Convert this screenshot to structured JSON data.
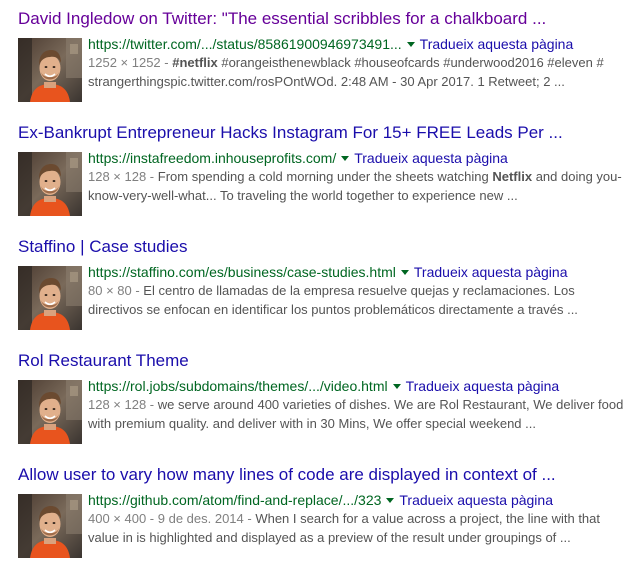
{
  "results": [
    {
      "title": "David Ingledow on Twitter: \"The essential scribbles for a chalkboard ...",
      "url": "https://twitter.com/.../status/85861900946973491...",
      "translate": "Tradueix aquesta pàgina",
      "meta": "1252 × 1252 - ",
      "snippet_html": "<b>#netflix</b> #orangeisthenewblack #houseofcards #underwood2016 #eleven # strangerthingspic.twitter.com/rosPOntWOd. 2:48 AM - 30 Apr 2017. 1 Retweet; 2 ...",
      "visited": true
    },
    {
      "title": "Ex-Bankrupt Entrepreneur Hacks Instagram For 15+ FREE Leads Per ...",
      "url": "https://instafreedom.inhouseprofits.com/",
      "translate": "Tradueix aquesta pàgina",
      "meta": "128 × 128 - ",
      "snippet_html": "From spending a cold morning under the sheets watching <b>Netflix</b> and doing you-know-very-well-what... To traveling the world together to experience new ...",
      "visited": false
    },
    {
      "title": "Staffino | Case studies",
      "url": "https://staffino.com/es/business/case-studies.html",
      "translate": "Tradueix aquesta pàgina",
      "meta": "80 × 80 - ",
      "snippet_html": "El centro de llamadas de la empresa resuelve quejas y reclamaciones. Los directivos se enfocan en identificar los puntos problemáticos directamente a través ...",
      "visited": false
    },
    {
      "title": "Rol Restaurant Theme",
      "url": "https://rol.jobs/subdomains/themes/.../video.html",
      "translate": "Tradueix aquesta pàgina",
      "meta": "128 × 128 - ",
      "snippet_html": "we serve around 400 varieties of dishes. We are Rol Restaurant, We deliver food with premium quality. and deliver with in 30 Mins, We offer special weekend ...",
      "visited": false
    },
    {
      "title": "Allow user to vary how many lines of code are displayed in context of ...",
      "url": "https://github.com/atom/find-and-replace/.../323",
      "translate": "Tradueix aquesta pàgina",
      "meta": "400 × 400 - 9 de des. 2014 - ",
      "snippet_html": "When I search for a value across a project, the line with that value in is highlighted and displayed as a preview of the result under groupings of ...",
      "visited": false
    }
  ],
  "colors": {
    "visited_link": "#660099",
    "link": "#1a0dab",
    "url_green": "#006621",
    "snippet_gray": "#545454",
    "meta_gray": "#808080"
  },
  "icons": {
    "thumbnail": "portrait-photo-icon",
    "dropdown": "triangle-down-icon"
  }
}
